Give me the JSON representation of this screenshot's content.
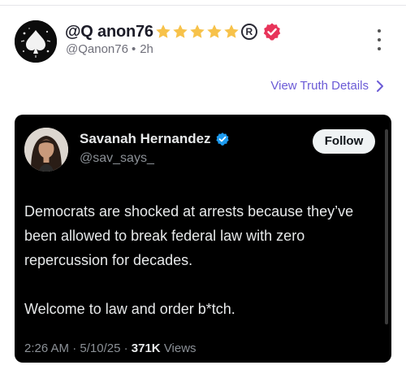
{
  "post": {
    "display_name": "@Q anon76",
    "star_count": 5,
    "registered_mark": "R",
    "handle": "@Qanon76",
    "separator": "•",
    "time_ago": "2h",
    "badge_color": "#e8345a",
    "star_color": "#f7c24a",
    "view_details_label": "View Truth Details"
  },
  "embedded_post": {
    "author_name": "Savanah Hernandez",
    "author_handle": "@sav_says_",
    "follow_label": "Follow",
    "verified_color": "#1d9bf0",
    "paragraphs": [
      "Democrats are shocked at arrests because they’ve been allowed to break federal law with zero repercussion for decades.",
      "Welcome to law and order b*tch."
    ],
    "time": "2:26 AM",
    "date": "5/10/25",
    "views_count": "371K",
    "views_label": "Views",
    "meta_separator": "·"
  }
}
